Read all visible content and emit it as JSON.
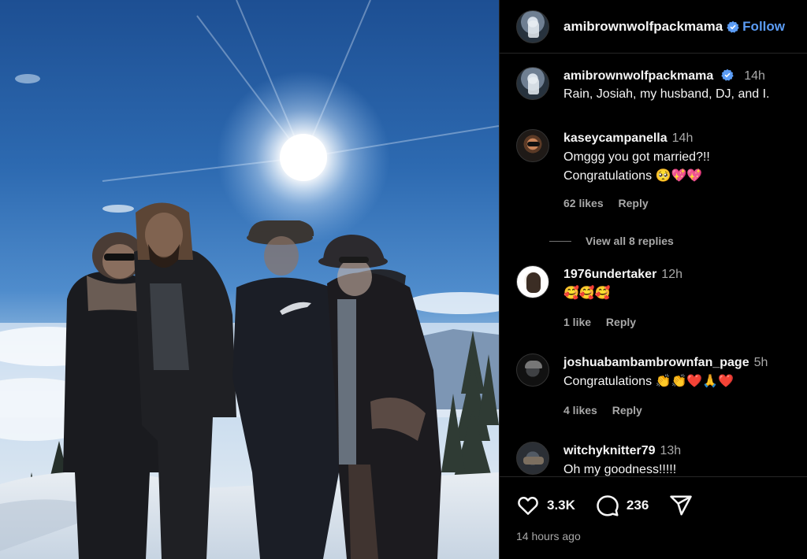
{
  "post": {
    "author": "amibrownwolfpackmama",
    "follow_label": "Follow"
  },
  "caption": {
    "author": "amibrownwolfpackmama",
    "time": "14h",
    "text": "Rain, Josiah, my husband, DJ, and I."
  },
  "comments": [
    {
      "user": "kaseycampanella",
      "time": "14h",
      "lines": [
        "Omggg you got married?!!",
        "Congratulations 🥺💖💖"
      ],
      "likes": "62 likes",
      "reply": "Reply",
      "view_replies": "View all 8 replies"
    },
    {
      "user": "1976undertaker",
      "time": "12h",
      "lines": [
        "🥰🥰🥰"
      ],
      "likes": "1 like",
      "reply": "Reply"
    },
    {
      "user": "joshuabambambrownfan_page",
      "time": "5h",
      "lines": [
        "Congratulations 👏👏❤️🙏❤️"
      ],
      "likes": "4 likes",
      "reply": "Reply"
    },
    {
      "user": "witchyknitter79",
      "time": "13h",
      "lines": [
        "Oh my goodness!!!!!"
      ]
    }
  ],
  "actions": {
    "like_count": "3.3K",
    "comment_count": "236",
    "time_ago": "14 hours ago"
  },
  "icons": {
    "verified": "verified-badge-icon",
    "like": "heart-icon",
    "comment": "comment-bubble-icon",
    "share": "paper-plane-icon"
  },
  "colors": {
    "background": "#000000",
    "accent": "#5b9cf5",
    "secondary_text": "#a8a8a8"
  }
}
